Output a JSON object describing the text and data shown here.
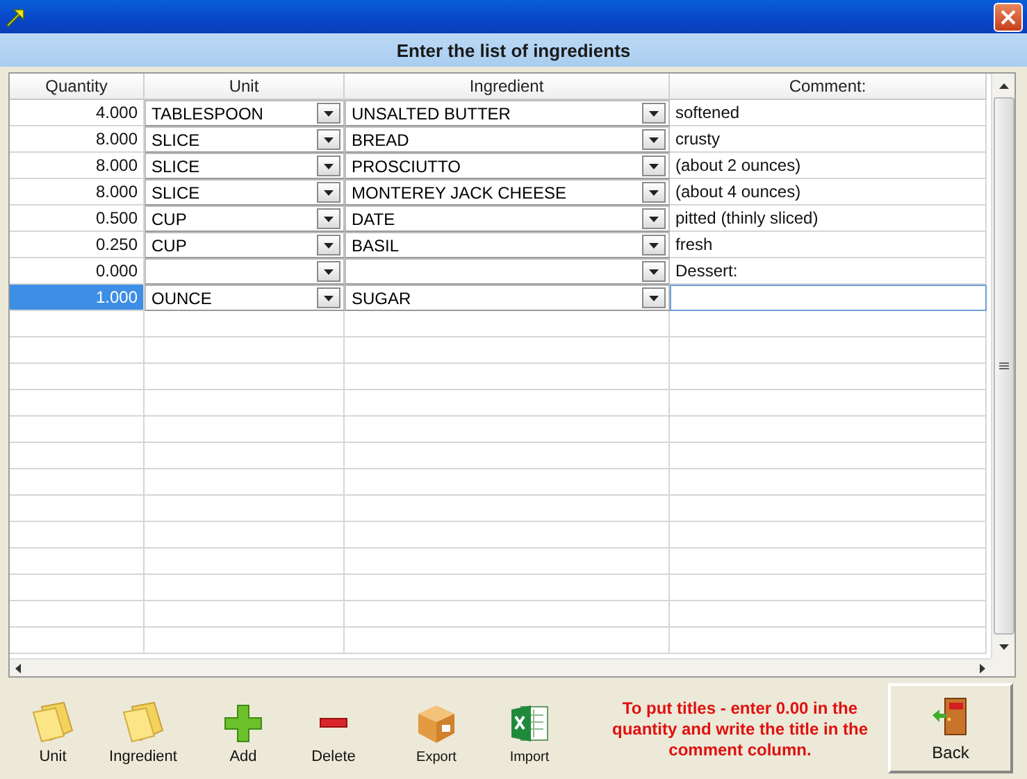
{
  "header": {
    "title": "Enter the list of ingredients"
  },
  "table": {
    "columns": [
      "Quantity",
      "Unit",
      "Ingredient",
      "Comment:"
    ],
    "rows": [
      {
        "quantity": "4.000",
        "unit": "TABLESPOON",
        "ingredient": "UNSALTED BUTTER",
        "comment": "softened",
        "selected": false
      },
      {
        "quantity": "8.000",
        "unit": "SLICE",
        "ingredient": "BREAD",
        "comment": "crusty",
        "selected": false
      },
      {
        "quantity": "8.000",
        "unit": "SLICE",
        "ingredient": "PROSCIUTTO",
        "comment": "(about 2 ounces)",
        "selected": false
      },
      {
        "quantity": "8.000",
        "unit": "SLICE",
        "ingredient": "MONTEREY JACK CHEESE",
        "comment": "(about 4 ounces)",
        "selected": false
      },
      {
        "quantity": "0.500",
        "unit": "CUP",
        "ingredient": "DATE",
        "comment": "pitted (thinly sliced)",
        "selected": false
      },
      {
        "quantity": "0.250",
        "unit": "CUP",
        "ingredient": "BASIL",
        "comment": "fresh",
        "selected": false
      },
      {
        "quantity": "0.000",
        "unit": "",
        "ingredient": "",
        "comment": "Dessert:",
        "selected": false
      },
      {
        "quantity": "1.000",
        "unit": "OUNCE",
        "ingredient": "SUGAR",
        "comment": "",
        "selected": true
      }
    ]
  },
  "toolbar": {
    "buttons": [
      {
        "kind": "unit",
        "label": "Unit"
      },
      {
        "kind": "ingredient",
        "label": "Ingredient"
      },
      {
        "kind": "add",
        "label": "Add"
      },
      {
        "kind": "delete",
        "label": "Delete"
      },
      {
        "kind": "export",
        "label": "Export"
      },
      {
        "kind": "import",
        "label": "Import"
      }
    ],
    "note": "To put titles - enter 0.00 in the quantity and write the title in the comment column.",
    "back": "Back"
  }
}
